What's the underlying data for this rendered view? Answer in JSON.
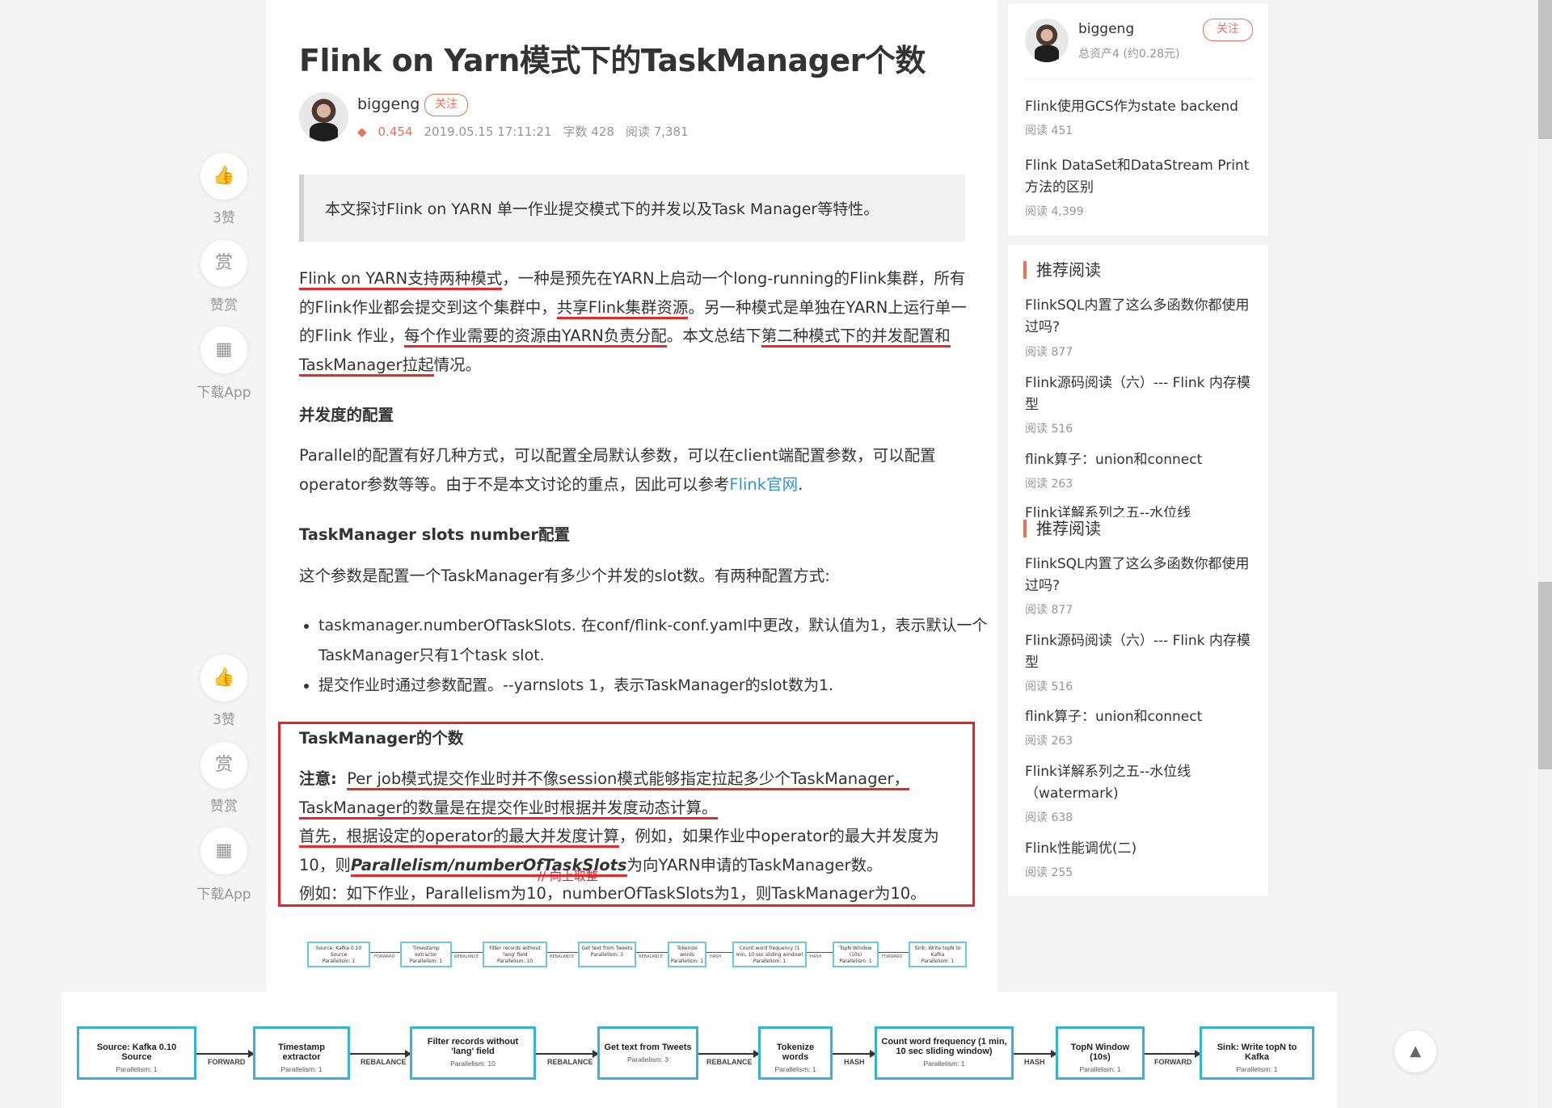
{
  "article": {
    "title": "Flink on Yarn模式下的TaskManager个数",
    "author": "biggeng",
    "follow_label": "关注",
    "diamond": "0.454",
    "date": "2019.05.15 17:11:21",
    "word_count": "字数 428",
    "reads": "阅读 7,381",
    "quote": "本文探讨Flink on YARN 单一作业提交模式下的并发以及Task Manager等特性。",
    "intro": {
      "s1": "Flink on YARN支持两种模式",
      "s2": "，一种是预先在YARN上启动一个long-running的Flink集群，所有的Flink作业都会提交到这个集群中，",
      "s3": "共享Flink集群资源",
      "s4": "。另一种模式是单独在YARN上运行单一的Flink 作业，",
      "s5": "每个作业需要的资源由YARN负责分配",
      "s6": "。本文总结下",
      "s7": "第二种模式下的并发配置和TaskManager拉起",
      "s8": "情况。"
    },
    "h_parallel": "并发度的配置",
    "parallel_text": "Parallel的配置有好几种方式，可以配置全局默认参数，可以在client端配置参数，可以配置operator参数等等。由于不是本文讨论的重点，因此可以参考",
    "parallel_link": "Flink官网",
    "parallel_end": ".",
    "h_slots": "TaskManager slots number配置",
    "slots_text": "这个参数是配置一个TaskManager有多少个并发的slot数。有两种配置方式:",
    "bullets": [
      "taskmanager.numberOfTaskSlots. 在conf/flink-conf.yaml中更改，默认值为1，表示默认一个TaskManager只有1个task slot.",
      "提交作业时通过参数配置。--yarnslots 1，表示TaskManager的slot数为1."
    ],
    "h_count": "TaskManager的个数",
    "note_label": "注意:",
    "note_text": "Per job模式提交作业时并不像session模式能够指定拉起多少个TaskManager，TaskManager的数量是在提交作业时根据并发度动态计算。",
    "first_u": "首先，根据设定的operator的最大并发度计算",
    "first_rest": "，例如，如果作业中operator的最大并发度为10，则",
    "formula": "Parallelism/numberOfTaskSlots",
    "formula_rest": "为向YARN申请的TaskManager数。",
    "example": "例如：如下作业，Parallelism为10，numberOfTaskSlots为1，则TaskManager为10。",
    "annotation": "// 向上取整"
  },
  "job_graph": {
    "nodes": [
      {
        "name": "Source: Kafka 0.10 Source",
        "parallelism": "Parallelism: 1"
      },
      {
        "name": "Timestamp extractor",
        "parallelism": "Parallelism: 1"
      },
      {
        "name": "Filter records without 'lang' field",
        "parallelism": "Parallelism: 10"
      },
      {
        "name": "Get text from Tweets",
        "parallelism": "Parallelism: 3"
      },
      {
        "name": "Tokenize words",
        "parallelism": "Parallelism: 1"
      },
      {
        "name": "Count word frequency (1 min, 10 sec sliding window)",
        "parallelism": "Parallelism: 1"
      },
      {
        "name": "TopN Window (10s)",
        "parallelism": "Parallelism: 1"
      },
      {
        "name": "Sink: Write topN to Kafka",
        "parallelism": "Parallelism: 1"
      }
    ],
    "edges": [
      "FORWARD",
      "REBALANCE",
      "REBALANCE",
      "REBALANCE",
      "HASH",
      "HASH",
      "FORWARD"
    ]
  },
  "side_actions": [
    {
      "icon": "thumbs-up-icon",
      "glyph": "👍",
      "label": "3赞"
    },
    {
      "icon": "reward-icon",
      "glyph": "赏",
      "label": "赞赏"
    },
    {
      "icon": "qr-code-icon",
      "glyph": "▦",
      "label": "下载App"
    }
  ],
  "sidebar": {
    "author": "biggeng",
    "assets": "总资产4 (约0.28元)",
    "follow_label": "关注",
    "author_articles": [
      {
        "title": "Flink使用GCS作为state backend",
        "reads": "阅读 451"
      },
      {
        "title": "Flink DataSet和DataStream Print方法的区别",
        "reads": "阅读 4,399"
      }
    ],
    "recommend_heading": "推荐阅读",
    "recommend": [
      {
        "title": "FlinkSQL内置了这么多函数你都使用过吗?",
        "reads": "阅读 877"
      },
      {
        "title": "Flink源码阅读（六）--- Flink 内存模型",
        "reads": "阅读 516"
      },
      {
        "title": "flink算子：union和connect",
        "reads": "阅读 263"
      },
      {
        "title": "Flink详解系列之五--水位线（watermark)",
        "reads": "阅读 638"
      },
      {
        "title": "Flink性能调优(二)",
        "reads": "阅读 255"
      }
    ]
  },
  "back_to_top": "▲"
}
